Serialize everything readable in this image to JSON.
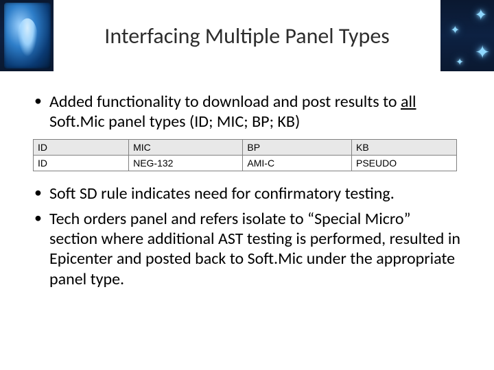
{
  "title": "Interfacing Multiple Panel Types",
  "bullet1": {
    "pre": "Added functionality to download and post results to ",
    "underlined": "all",
    "post": " Soft.Mic panel types (ID; MIC; BP; KB)"
  },
  "table": {
    "headers": [
      "ID",
      "MIC",
      "BP",
      "KB"
    ],
    "row": [
      "ID",
      "NEG-132",
      "AMI-C",
      "PSEUDO"
    ]
  },
  "bullet2": "Soft SD rule indicates need for confirmatory testing.",
  "bullet3": "Tech orders panel and refers isolate to “Special Micro” section where additional AST testing is performed, resulted in Epicenter and posted back to Soft.Mic under the appropriate panel type.",
  "icon": {
    "name": "anatomy-avatar-icon"
  }
}
